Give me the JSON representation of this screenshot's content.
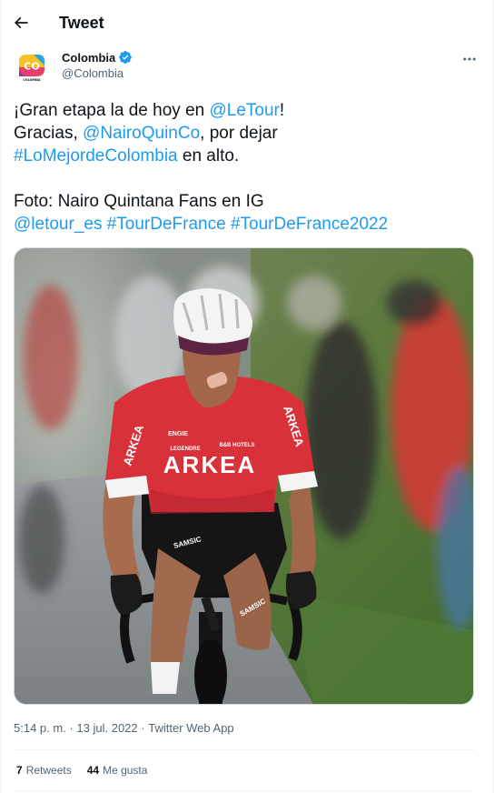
{
  "header": {
    "title": "Tweet"
  },
  "author": {
    "display_name": "Colombia",
    "handle": "@Colombia",
    "avatar_text": "CO",
    "avatar_subtext": "COLOMBIA"
  },
  "tweet": {
    "line1_pre": "¡Gran etapa la de hoy en ",
    "line1_link": "@LeTour",
    "line1_post": "!",
    "line2_pre": "Gracias, ",
    "line2_link": "@NairoQuinCo",
    "line2_post": ", por dejar",
    "line3_link": "#LoMejordeColombia",
    "line3_post": " en alto.",
    "line4": "Foto: Nairo Quintana Fans en IG",
    "line5_link1": "@letour_es",
    "line5_link2": "#TourDeFrance",
    "line5_link3": "#TourDeFrance2022"
  },
  "media": {
    "jersey_text": "ARKEA",
    "sleeve_text_left": "ARKEA",
    "sleeve_text_right": "ARKEA",
    "sponsor_1": "ENGIE",
    "sponsor_2": "LEGENDRE",
    "sponsor_3": "B&B HOTELS",
    "shorts_text_left": "SAMSIC",
    "shorts_text_right": "SAMSIC"
  },
  "meta": {
    "time": "5:14 p. m.",
    "date": "13 jul. 2022",
    "source": "Twitter Web App",
    "dot": "·"
  },
  "stats": {
    "retweets_count": "7",
    "retweets_label": "Retweets",
    "likes_count": "44",
    "likes_label": "Me gusta"
  },
  "colors": {
    "link": "#1d9bf0",
    "text": "#0f1419",
    "secondary": "#536471",
    "verified": "#1d9bf0"
  },
  "icons": {
    "back": "arrow-left-icon",
    "verified": "verified-badge-icon",
    "more": "more-horizontal-icon"
  }
}
